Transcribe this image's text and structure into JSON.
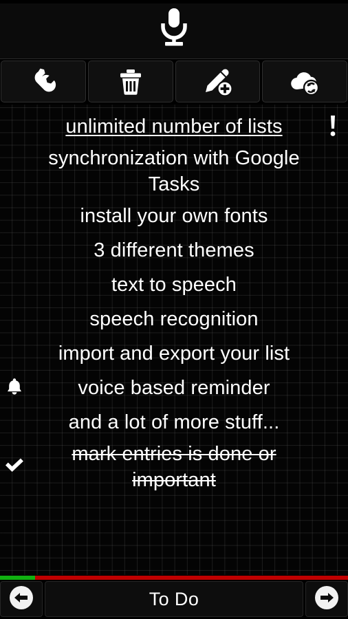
{
  "header": {
    "mic_icon": "microphone-icon",
    "mic_label": "Voice input"
  },
  "toolbar": {
    "buttons": [
      {
        "name": "settings-button",
        "icon": "wrench-icon",
        "label": "Settings"
      },
      {
        "name": "delete-button",
        "icon": "trash-icon",
        "label": "Delete"
      },
      {
        "name": "add-entry-button",
        "icon": "pencil-plus-icon",
        "label": "Add entry"
      },
      {
        "name": "sync-button",
        "icon": "cloud-sync-icon",
        "label": "Sync"
      }
    ]
  },
  "list": {
    "items": [
      {
        "text": "unlimited number of lists",
        "style": "underlined",
        "lead_icon": null,
        "trail_icon": "exclamation-icon"
      },
      {
        "text": "synchronization with Google Tasks",
        "style": "normal",
        "lead_icon": null,
        "trail_icon": null
      },
      {
        "text": "install your own fonts",
        "style": "normal",
        "lead_icon": null,
        "trail_icon": null
      },
      {
        "text": "3 different themes",
        "style": "normal",
        "lead_icon": null,
        "trail_icon": null
      },
      {
        "text": "text to speech",
        "style": "normal",
        "lead_icon": null,
        "trail_icon": null
      },
      {
        "text": "speech recognition",
        "style": "normal",
        "lead_icon": null,
        "trail_icon": null
      },
      {
        "text": "import and export your list",
        "style": "normal",
        "lead_icon": null,
        "trail_icon": null
      },
      {
        "text": "voice based reminder",
        "style": "normal",
        "lead_icon": "bell-icon",
        "trail_icon": null
      },
      {
        "text": "and a lot of more stuff...",
        "style": "normal",
        "lead_icon": null,
        "trail_icon": null
      },
      {
        "text": "mark entries is done or important",
        "style": "struck",
        "lead_icon": "check-icon",
        "trail_icon": null
      }
    ]
  },
  "progress": {
    "done_percent": 10,
    "done_color": "#11b111",
    "remaining_color": "#c00000"
  },
  "bottom": {
    "prev_label": "Previous list",
    "prev_icon": "arrow-left-circle-icon",
    "title": "To Do",
    "next_label": "Next list",
    "next_icon": "arrow-right-circle-icon"
  }
}
